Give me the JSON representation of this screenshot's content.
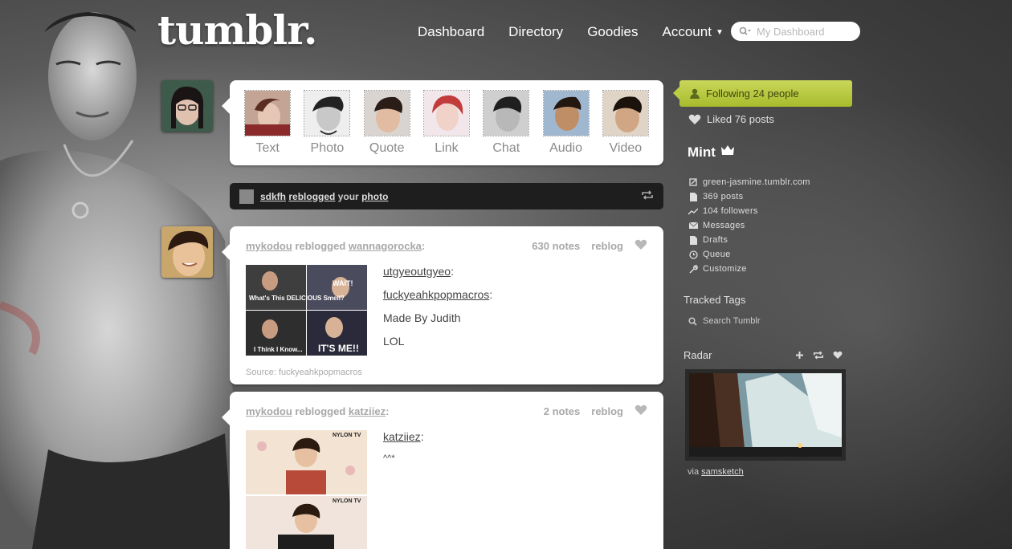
{
  "header": {
    "logo": "tumblr.",
    "nav": [
      "Dashboard",
      "Directory",
      "Goodies",
      "Account"
    ],
    "search_placeholder": "My Dashboard"
  },
  "post_types": [
    "Text",
    "Photo",
    "Quote",
    "Link",
    "Chat",
    "Audio",
    "Video"
  ],
  "notice": {
    "user": "sdkfh",
    "action": "reblogged",
    "middle": "your",
    "object": "photo"
  },
  "posts": [
    {
      "user": "mykodou",
      "action": "reblogged",
      "source_user": "wannagorocka",
      "notes": "630 notes",
      "reblog": "reblog",
      "image_captions": [
        "What's This DELICIOUS Smell?",
        "WAIT!",
        "I Think I Know...",
        "IT'S ME!!"
      ],
      "lines": [
        {
          "text": "utgyeoutgyeo",
          "link": true
        },
        {
          "text": "fuckyeahkpopmacros",
          "link": true
        },
        {
          "text": "Made By Judith",
          "link": false
        },
        {
          "text": "LOL",
          "link": false
        }
      ],
      "source": "Source: fuckyeahkpopmacros"
    },
    {
      "user": "mykodou",
      "action": "reblogged",
      "source_user": "katziiez",
      "notes": "2 notes",
      "reblog": "reblog",
      "image_captions": [
        "NYLON TV",
        "NYLON TV"
      ],
      "lines": [
        {
          "text": "katziiez",
          "link": true
        },
        {
          "text": "^^*",
          "link": false
        }
      ]
    }
  ],
  "sidebar": {
    "following": "Following 24 people",
    "liked": "Liked 76 posts",
    "blog_name": "Mint",
    "links": [
      {
        "icon": "edit-icon",
        "label": "green-jasmine.tumblr.com"
      },
      {
        "icon": "document-icon",
        "label": "369 posts"
      },
      {
        "icon": "trend-icon",
        "label": "104 followers"
      },
      {
        "icon": "mail-icon",
        "label": "Messages"
      },
      {
        "icon": "document-icon",
        "label": "Drafts"
      },
      {
        "icon": "clock-icon",
        "label": "Queue"
      },
      {
        "icon": "wrench-icon",
        "label": "Customize"
      }
    ],
    "tracked_tags": "Tracked Tags",
    "search_tumblr": "Search Tumblr",
    "radar": "Radar",
    "radar_via": "via",
    "radar_user": "samsketch"
  },
  "colors": {
    "follow_bg": "#bacb3d",
    "notice_bg": "#1e1e1e",
    "post_bg": "#ffffff",
    "meta_text": "#a8a8a8"
  }
}
